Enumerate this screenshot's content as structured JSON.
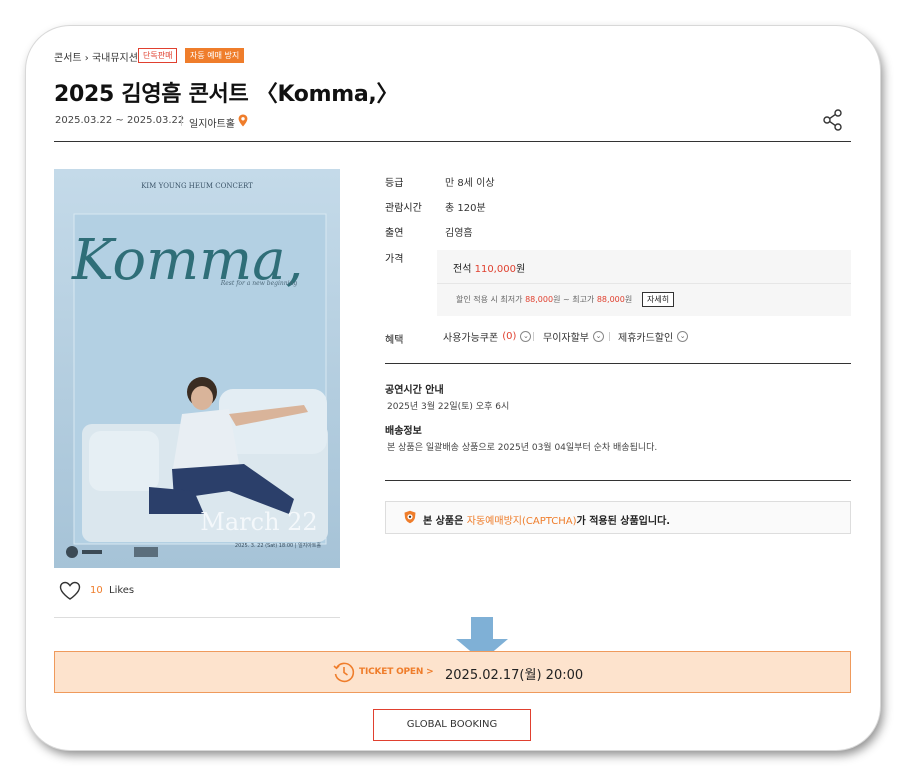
{
  "breadcrumb": {
    "text": "콘서트 › 국내뮤지션"
  },
  "badges": {
    "exclusive": "단독판매",
    "captcha": "자동 예매 방지"
  },
  "title": "2025 김영흠 콘서트 〈Komma,〉",
  "schedule": {
    "dates": "2025.03.22 ~ 2025.03.22",
    "venue": "일지아트홀"
  },
  "poster": {
    "header": "KIM YOUNG HEUM CONCERT",
    "script_title": "Komma,",
    "tagline": "Rest for a new beginning",
    "date_large": "March 22",
    "footer_info": "2025. 3. 22 (Sat) 18:00 | 일지아트홀",
    "background_color": "#b9d3e4",
    "figure_shirt_color": "#e8eef3",
    "figure_pants_color": "#2b3f6a"
  },
  "likes": {
    "count": "10",
    "label": "Likes"
  },
  "info": {
    "rating_label": "등급",
    "rating_value": "만 8세 이상",
    "runtime_label": "관람시간",
    "runtime_value": "총 120분",
    "cast_label": "출연",
    "cast_value": "김영흠",
    "price_label": "가격",
    "price_seat": "전석",
    "price_amount": "110,000",
    "price_unit": "원",
    "discount_prefix": "할인 적용 시 최저가",
    "discount_min": "88,000",
    "discount_mid": "원 ~ 최고가",
    "discount_max": "88,000",
    "discount_suffix": "원",
    "detail_button": "자세히",
    "benefit_label": "혜택",
    "benefit_coupon": "사용가능쿠폰",
    "benefit_coupon_count": "(0)",
    "benefit_installment": "무이자할부",
    "benefit_card": "제휴카드할인"
  },
  "notice": {
    "show_time_heading": "공연시간 안내",
    "show_time_text": "2025년 3월 22일(토) 오후 6시",
    "delivery_heading": "배송정보",
    "delivery_text": "본 상품은 일괄배송 상품으로 2025년 03월 04일부터 순차 배송됩니다."
  },
  "captcha": {
    "prefix": "본 상품은",
    "highlight": "자동예매방지(CAPTCHA)",
    "suffix": "가 적용된 상품입니다."
  },
  "ticket_open": {
    "label": "TICKET OPEN >",
    "datetime": "2025.02.17(월) 20:00"
  },
  "global_booking": "GLOBAL BOOKING",
  "colors": {
    "accent_orange": "#ef7d2b",
    "accent_red": "#e0402f",
    "ticket_bar_bg": "#fde3cd",
    "arrow_blue": "#7fb0d6"
  }
}
